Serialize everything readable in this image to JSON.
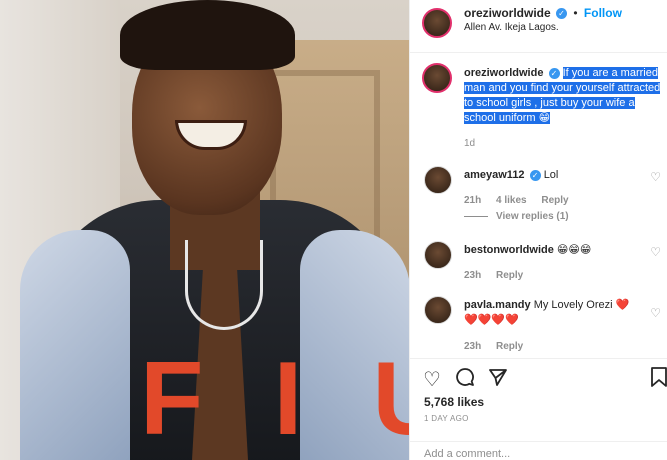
{
  "post": {
    "author": "oreziworldwide",
    "follow_label": "Follow",
    "location": "Allen Av. Ikeja Lagos.",
    "caption_text": "If you are a married man and you find your yourself attracted to school girls , just buy your wife a school uniform 😁",
    "caption_age": "1d",
    "likes": "5,768 likes",
    "posted": "1 DAY AGO",
    "add_comment_placeholder": "Add a comment..."
  },
  "comments": [
    {
      "user": "ameyaw112",
      "verified": true,
      "text": "Lol",
      "age": "21h",
      "likes": "4 likes",
      "reply": "Reply",
      "view_replies": "View replies (1)"
    },
    {
      "user": "bestonworldwide",
      "verified": false,
      "text": "😁😁😁",
      "age": "23h",
      "reply": "Reply"
    },
    {
      "user": "pavla.mandy",
      "verified": false,
      "text": "My Lovely Orezi ❤️",
      "text2": "❤️❤️❤️❤️",
      "age": "23h",
      "reply": "Reply"
    }
  ],
  "photo": {
    "jacket_letters": "FIUN"
  },
  "colors": {
    "link": "#0095f6",
    "verified": "#3897f0",
    "highlight": "#1e6fe8",
    "heart": "#ed2840"
  },
  "icons": [
    "heart-icon",
    "comment-icon",
    "share-icon",
    "bookmark-icon",
    "verified-icon"
  ]
}
